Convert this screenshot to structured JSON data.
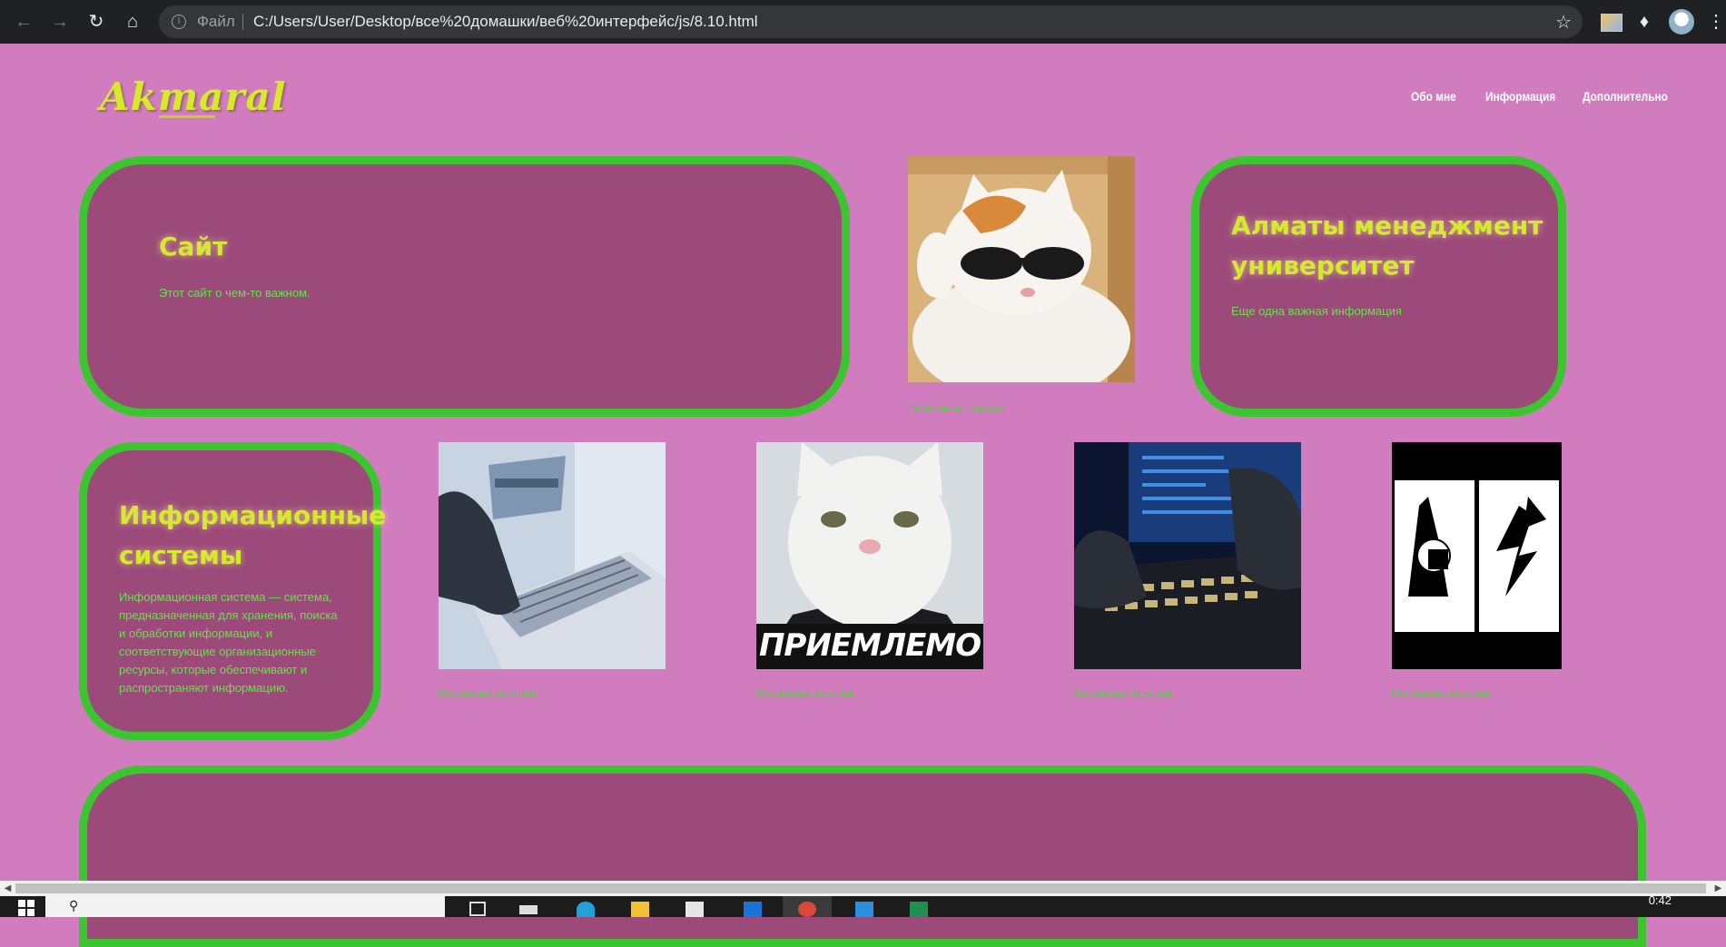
{
  "browser": {
    "file_label": "Файл",
    "url": "C:/Users/User/Desktop/все%20домашки/веб%20интерфейс/js/8.10.html"
  },
  "page": {
    "logo": "Akmaral",
    "nav": [
      "Обо мне",
      "Информация",
      "Дополнительно"
    ],
    "cards": [
      {
        "title": "Сайт",
        "text": "Этот сайт о чем-то важном."
      },
      {
        "title": "Алматы менеджмент университет",
        "text": "Еще одна важная информация"
      },
      {
        "title": "Информационные системы",
        "text": "Информационная система — система, предназначенная для хранения, поиска и обработки информации, и соответствующие организационные ресурсы, которые обеспечивают и распространяют информацию."
      }
    ],
    "photos": [
      {
        "caption": "Полезные ссылки"
      },
      {
        "caption": "Полезные ссылки"
      },
      {
        "caption": "Полезные ссылки",
        "overlay": "ПРИЕМЛЕМО"
      },
      {
        "caption": "Полезные ссылки"
      },
      {
        "caption": "Полезные ссылки"
      }
    ]
  },
  "taskbar": {
    "clock": "0:42"
  },
  "colors": {
    "page_bg": "#d17cbf",
    "card_bg": "#9c4a7a",
    "card_border": "#3cc531",
    "title_yellow": "#d5ea2e",
    "text_green": "#66e24a"
  }
}
